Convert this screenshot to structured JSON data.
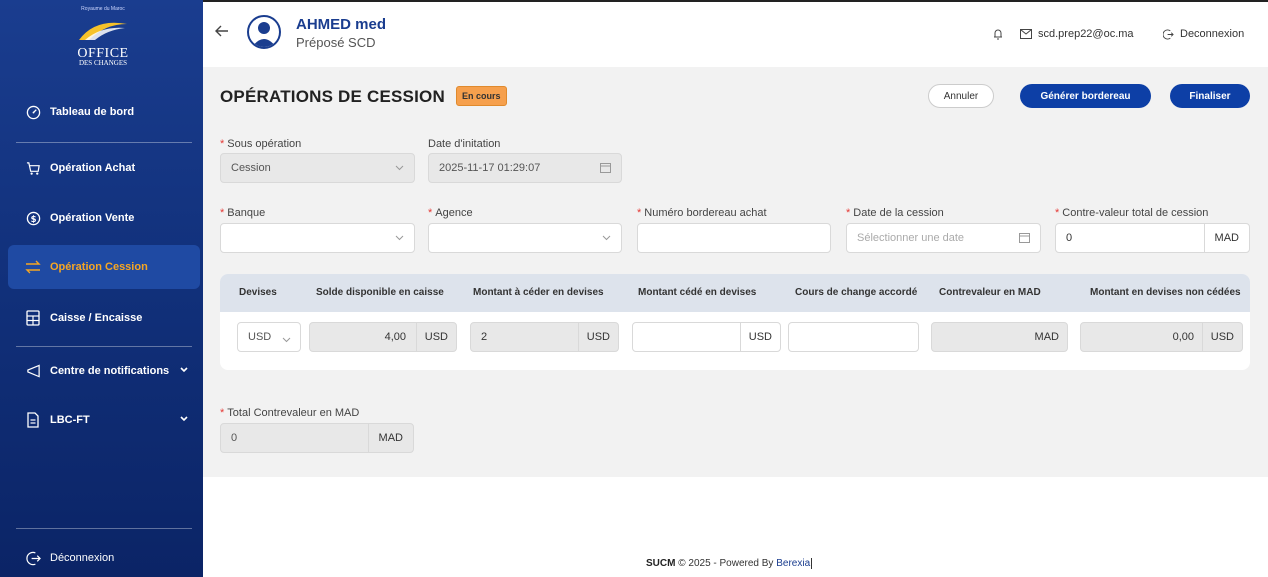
{
  "sidebar": {
    "logo": {
      "top": "Royaume du Maroc",
      "main": "OFFICE",
      "sub": "DES CHANGES"
    },
    "items": [
      {
        "label": "Tableau de bord",
        "icon": "dashboard-icon"
      },
      {
        "label": "Opération Achat",
        "icon": "cart-icon"
      },
      {
        "label": "Opération Vente",
        "icon": "dollar-icon"
      },
      {
        "label": "Opération Cession",
        "icon": "swap-icon",
        "active": true
      },
      {
        "label": "Caisse / Encaisse",
        "icon": "calculator-icon"
      },
      {
        "label": "Centre de notifications",
        "icon": "megaphone-icon"
      },
      {
        "label": "LBC-FT",
        "icon": "document-icon"
      }
    ],
    "logout_label": "Déconnexion"
  },
  "header": {
    "user_name": "AHMED med",
    "user_role": "Préposé SCD",
    "email": "scd.prep22@oc.ma",
    "logout_label": "Deconnexion"
  },
  "page": {
    "title": "OPÉRATIONS DE CESSION",
    "status_badge": "En cours",
    "buttons": {
      "cancel": "Annuler",
      "generate": "Générer bordereau",
      "finalize": "Finaliser"
    }
  },
  "form": {
    "sous_operation": {
      "label": "Sous opération",
      "value": "Cession"
    },
    "date_initiation": {
      "label": "Date d'initation",
      "value": "2025-11-17 01:29:07"
    },
    "banque": {
      "label": "Banque",
      "value": ""
    },
    "agence": {
      "label": "Agence",
      "value": ""
    },
    "numero_bordereau": {
      "label": "Numéro bordereau achat",
      "value": ""
    },
    "date_cession": {
      "label": "Date de la cession",
      "placeholder": "Sélectionner une date"
    },
    "contre_valeur": {
      "label": "Contre-valeur total de cession",
      "value": "0",
      "suffix": "MAD"
    },
    "total_contrevaleur": {
      "label": "Total Contrevaleur en MAD",
      "value": "0",
      "suffix": "MAD"
    }
  },
  "table": {
    "headers": [
      "Devises",
      "Solde disponible en caisse",
      "Montant à céder en devises",
      "Montant cédé en devises",
      "Cours de change accordé",
      "Contrevaleur en MAD",
      "Montant en devises non cédées"
    ],
    "row": {
      "devise": "USD",
      "solde": "4,00",
      "solde_suffix": "USD",
      "montant_a_ceder": "2",
      "montant_a_ceder_suffix": "USD",
      "montant_cede": "",
      "montant_cede_suffix": "USD",
      "cours": "",
      "contrevaleur": "",
      "contrevaleur_suffix": "MAD",
      "non_cedees": "0,00",
      "non_cedees_suffix": "USD"
    }
  },
  "footer": {
    "brand": "SUCM",
    "copyright": " © 2025 - Powered By ",
    "link": "Berexia"
  },
  "colors": {
    "brand": "#1a3d8f",
    "accent": "#f6a623",
    "primary_button": "#0d3fa6",
    "badge": "#f6a04d"
  }
}
